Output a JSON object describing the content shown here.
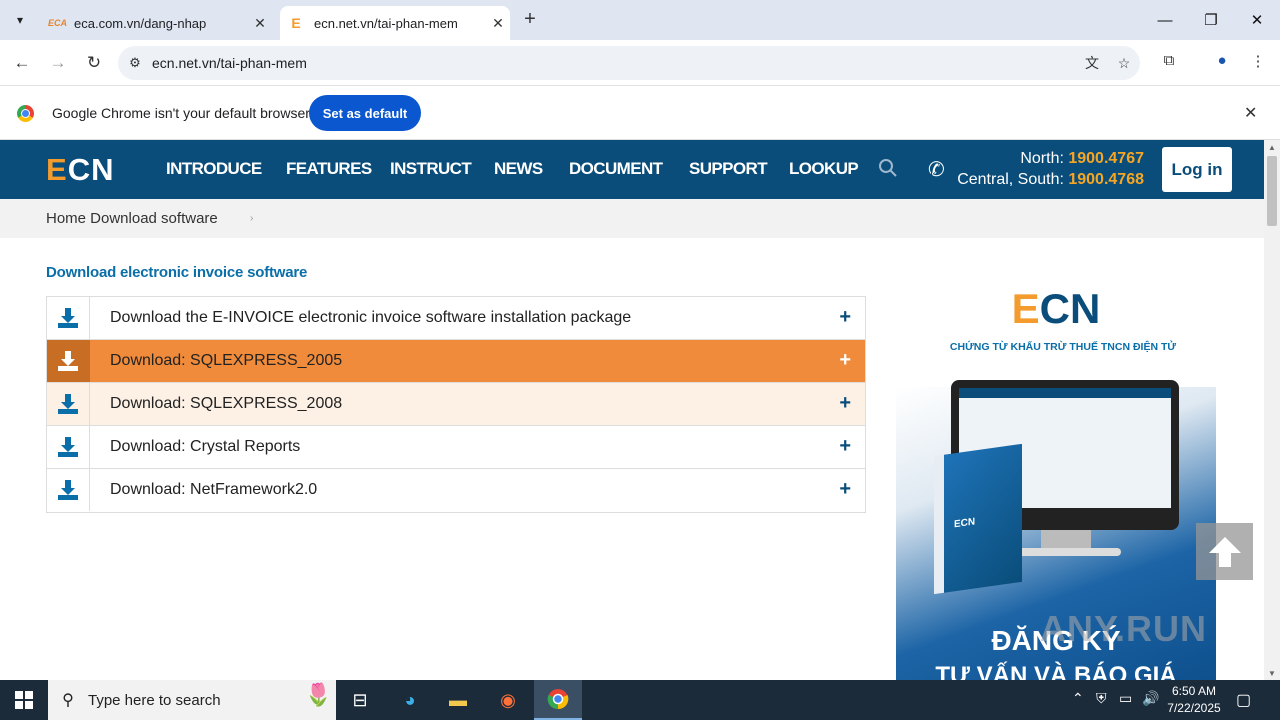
{
  "browser": {
    "tabs": [
      {
        "favicon": "ECA",
        "title": "eca.com.vn/dang-nhap",
        "active": false
      },
      {
        "favicon": "E",
        "title": "ecn.net.vn/tai-phan-mem",
        "active": true
      }
    ],
    "url": "ecn.net.vn/tai-phan-mem",
    "infobar": {
      "message": "Google Chrome isn't your default browser",
      "button": "Set as default"
    },
    "icons": [
      "tab-list-icon",
      "close-icon",
      "new-tab-icon",
      "minimize-icon",
      "restore-icon",
      "back-icon",
      "forward-icon",
      "reload-icon",
      "site-info-icon",
      "translate-icon",
      "bookmark-star-icon",
      "extensions-icon",
      "profile-icon",
      "menu-icon"
    ]
  },
  "site": {
    "logo": {
      "e": "E",
      "rest": "CN"
    },
    "nav": [
      "INTRODUCE",
      "FEATURES",
      "INSTRUCT",
      "NEWS",
      "DOCUMENT",
      "SUPPORT",
      "LOOKUP"
    ],
    "hotline": {
      "north_label": "North: ",
      "north_number": "1900.4767",
      "central_label": "Central, South: ",
      "central_number": "1900.4768"
    },
    "login": "Log in",
    "breadcrumb": "Home Download software",
    "breadcrumb_sep": "›",
    "section_title": "Download electronic invoice software",
    "downloads": [
      {
        "label": "Download the E-INVOICE electronic invoice software installation package",
        "state": "normal"
      },
      {
        "label": "Download: SQLEXPRESS_2005",
        "state": "active"
      },
      {
        "label": "Download: SQLEXPRESS_2008",
        "state": "hover"
      },
      {
        "label": "Download: Crystal Reports",
        "state": "normal"
      },
      {
        "label": "Download: NetFramework2.0",
        "state": "normal"
      }
    ],
    "expand_symbol": "+",
    "banner": {
      "logo_e": "E",
      "logo_rest": "CN",
      "subtitle": "CHỨNG TỪ KHẤU TRỪ THUẾ TNCN ĐIỆN TỬ",
      "box_label": "ECN",
      "line1": "ĐĂNG KÝ",
      "line2": "TƯ VẤN VÀ BÁO GIÁ"
    },
    "watermark": "ANY.RUN"
  },
  "taskbar": {
    "search_placeholder": "Type here to search",
    "time": "6:50 AM",
    "date": "7/22/2025"
  },
  "colors": {
    "nav_bg": "#0a4d7a",
    "accent_orange": "#ef8b3a",
    "hotline_number": "#f6a623",
    "chrome_button": "#0b57d0"
  }
}
